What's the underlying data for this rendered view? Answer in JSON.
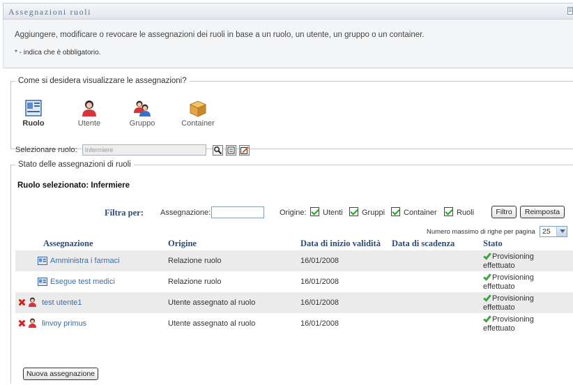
{
  "window": {
    "title": "Assegnazioni ruoli"
  },
  "intro": {
    "description": "Aggiungere, modificare o revocare le assegnazioni dei ruoli in base a un ruolo, un utente, un gruppo o un container.",
    "required_note": "* - indica che è obbligatorio."
  },
  "view": {
    "legend": "Come si desidera visualizzare le assegnazioni?",
    "options": [
      {
        "label": "Ruolo",
        "icon": "role-card-icon",
        "selected": true
      },
      {
        "label": "Utente",
        "icon": "user-icon",
        "selected": false
      },
      {
        "label": "Gruppo",
        "icon": "group-icon",
        "selected": false
      },
      {
        "label": "Container",
        "icon": "box-icon",
        "selected": false
      }
    ],
    "role_label": "Selezionare ruolo:",
    "role_value": "Infermiere"
  },
  "status": {
    "legend": "Stato delle assegnazioni di ruoli",
    "selected_role": "Ruolo selezionato: Infermiere",
    "filter": {
      "label": "Filtra per:",
      "assignment_label": "Assegnazione:",
      "assignment_value": "",
      "origin_label": "Origine:",
      "checkboxes": [
        {
          "label": "Utenti",
          "checked": true
        },
        {
          "label": "Gruppi",
          "checked": true
        },
        {
          "label": "Container",
          "checked": true
        },
        {
          "label": "Ruoli",
          "checked": true
        }
      ],
      "filter_button": "Filtro",
      "reset_button": "Reimposta"
    },
    "rows_per_page_label": "Numero massimo di righe per pagina",
    "rows_per_page": "25",
    "columns": [
      "Assegnazione",
      "Origine",
      "Data di inizio validità",
      "Data di scadenza",
      "Stato"
    ],
    "rows": [
      {
        "assignment": "Amministra i farmaci",
        "origin": "Relazione ruolo",
        "start": "",
        "end": "",
        "status_line1": "Provisioning",
        "status_line2": "effettuato",
        "type": "role"
      },
      {
        "assignment": "Esegue test medici",
        "origin": "Relazione ruolo",
        "start": "",
        "end": "",
        "status_line1": "Provisioning",
        "status_line2": "effettuato",
        "type": "role"
      },
      {
        "assignment": "test utente1",
        "origin": "Utente assegnato al ruolo",
        "start": "16/01/2008",
        "end": "",
        "status_line1": "Provisioning",
        "status_line2": "effettuato",
        "type": "user"
      },
      {
        "assignment": "linvoy primus",
        "origin": "Utente assegnato al ruolo",
        "start": "16/01/2008",
        "end": "",
        "status_line1": "Provisioning",
        "status_line2": "effettuato",
        "type": "user"
      }
    ],
    "row_start_dates_col": [
      "16/01/2008",
      "16/01/2008",
      "16/01/2008",
      "16/01/2008"
    ],
    "new_assignment_button": "Nuova assegnazione"
  },
  "colors": {
    "header_text": "#2e4a72",
    "link": "#3a6ea5",
    "check": "#3ea53e",
    "delete": "#d42020"
  }
}
